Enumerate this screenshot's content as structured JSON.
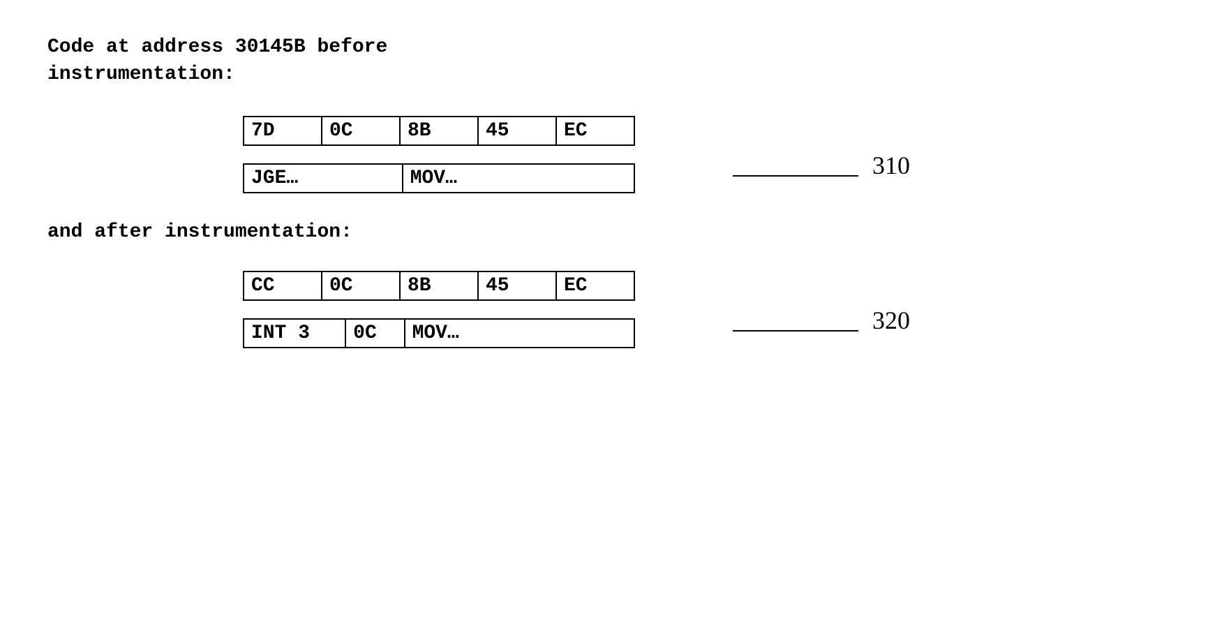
{
  "title_line1": "Code at address 30145B before",
  "title_line2": "instrumentation:",
  "before": {
    "bytes": [
      "7D",
      "0C",
      "8B",
      "45",
      "EC"
    ],
    "asm": [
      "JGE…",
      "MOV…"
    ],
    "ref": "310"
  },
  "subtitle": "and after instrumentation:",
  "after": {
    "bytes": [
      "CC",
      "0C",
      "8B",
      "45",
      "EC"
    ],
    "asm": [
      "INT 3",
      "0C",
      "MOV…"
    ],
    "ref": "320"
  }
}
